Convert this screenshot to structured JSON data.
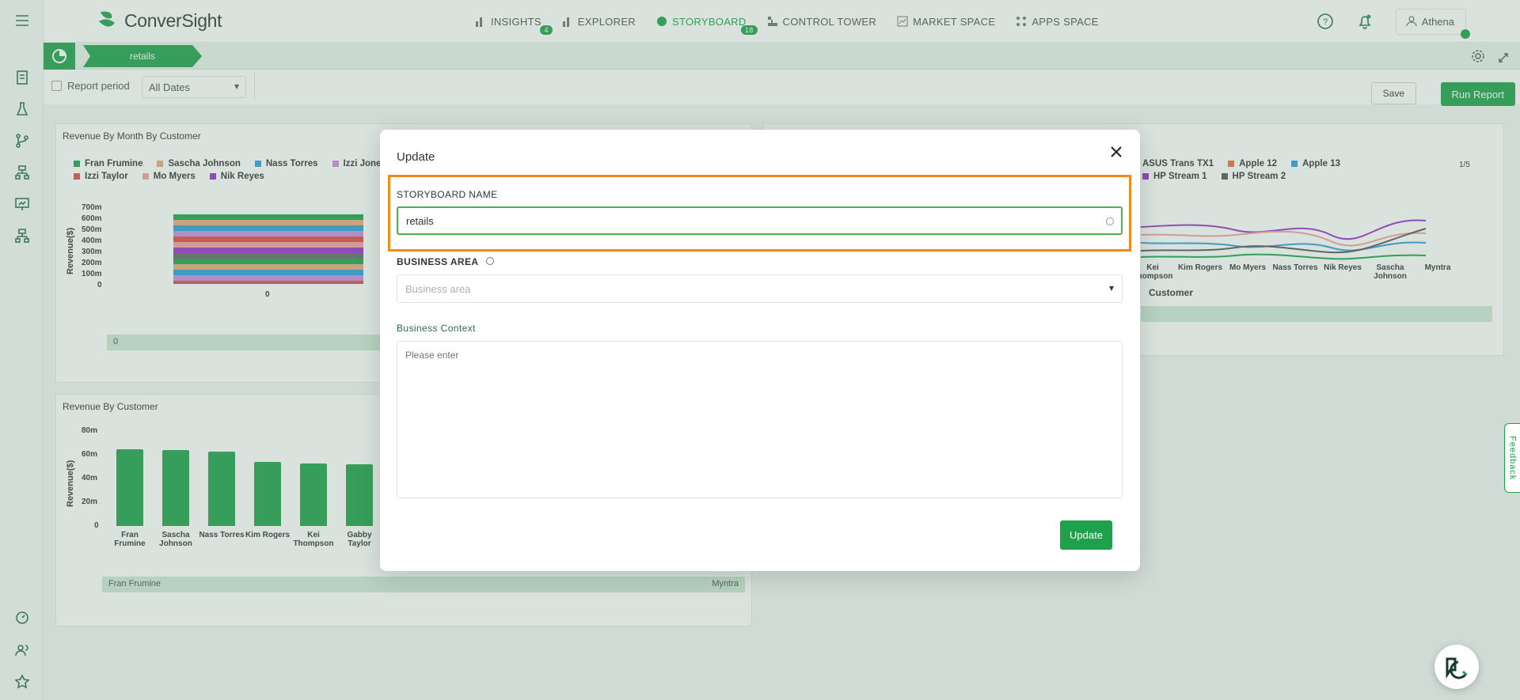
{
  "app": {
    "brand": "ConverSight"
  },
  "nav": [
    {
      "label": "INSIGHTS",
      "badge": "4",
      "icon": "bar-chart-icon"
    },
    {
      "label": "EXPLORER",
      "badge": "",
      "icon": "explorer-icon"
    },
    {
      "label": "STORYBOARD",
      "badge": "18",
      "icon": "storyboard-icon"
    },
    {
      "label": "CONTROL TOWER",
      "badge": "",
      "icon": "control-tower-icon"
    },
    {
      "label": "MARKET SPACE",
      "badge": "",
      "icon": "market-icon"
    },
    {
      "label": "APPS SPACE",
      "badge": "",
      "icon": "apps-icon"
    }
  ],
  "user": {
    "name": "Athena"
  },
  "breadcrumb": {
    "current": "retails"
  },
  "filters": {
    "report_period_label": "Report period",
    "report_period_value": "All Dates",
    "save": "Save",
    "run": "Run Report"
  },
  "widgets": {
    "revenue_month": {
      "title": "Revenue By Month By Customer",
      "legend": [
        {
          "name": "Fran Frumine",
          "color": "#1ea14a"
        },
        {
          "name": "Sascha Johnson",
          "color": "#e8a878"
        },
        {
          "name": "Nass Torres",
          "color": "#2b9de0"
        },
        {
          "name": "Izzi Jones",
          "color": "#c58ee0"
        },
        {
          "name": "Izzi Taylor",
          "color": "#e04848"
        },
        {
          "name": "Mo Myers",
          "color": "#f0a0a0"
        },
        {
          "name": "Nik Reyes",
          "color": "#9b30c8"
        }
      ],
      "yticks": [
        "700m",
        "600m",
        "500m",
        "400m",
        "300m",
        "200m",
        "100m",
        "0"
      ],
      "ylabel": "Revenue($)",
      "xtick": "0",
      "slider": "0"
    },
    "revenue_customer": {
      "title": "Revenue By Customer",
      "yticks": [
        "80m",
        "60m",
        "40m",
        "20m",
        "0"
      ],
      "ylabel": "Revenue($)",
      "slider_start": "Fran Frumine",
      "slider_end": "Myntra"
    },
    "right_chart": {
      "legend": [
        {
          "name": "ASUS Trans TX1",
          "color": "#9b30c8"
        },
        {
          "name": "Apple 12",
          "color": "#f07030"
        },
        {
          "name": "Apple 13",
          "color": "#2b9de0"
        },
        {
          "name": "HP Stream 1",
          "color": "#9b30c8"
        },
        {
          "name": "HP Stream 2",
          "color": "#555555"
        }
      ],
      "pager": "1/5",
      "xlabel": "Customer"
    }
  },
  "chart_data": [
    {
      "type": "bar",
      "title": "Revenue By Customer",
      "ylabel": "Revenue($)",
      "ylim": [
        0,
        80
      ],
      "categories": [
        "Fran Frumine",
        "Sascha Johnson",
        "Nass Torres",
        "Kim Rogers",
        "Kei Thompson",
        "Gabby Taylor"
      ],
      "values": [
        65,
        64,
        63,
        54,
        53,
        52
      ]
    },
    {
      "type": "line",
      "xlabel": "Customer",
      "categories": [
        "Kei Thompson",
        "Kim Rogers",
        "Mo Myers",
        "Nass Torres",
        "Nik Reyes",
        "Sascha Johnson",
        "Myntra"
      ]
    }
  ],
  "modal": {
    "title": "Update",
    "storyboard_label": "STORYBOARD NAME",
    "storyboard_value": "retails",
    "business_area_label": "BUSINESS AREA",
    "business_area_placeholder": "Business area",
    "context_label": "Business Context",
    "context_placeholder": "Please enter",
    "update": "Update"
  },
  "feedback": "Feedback"
}
